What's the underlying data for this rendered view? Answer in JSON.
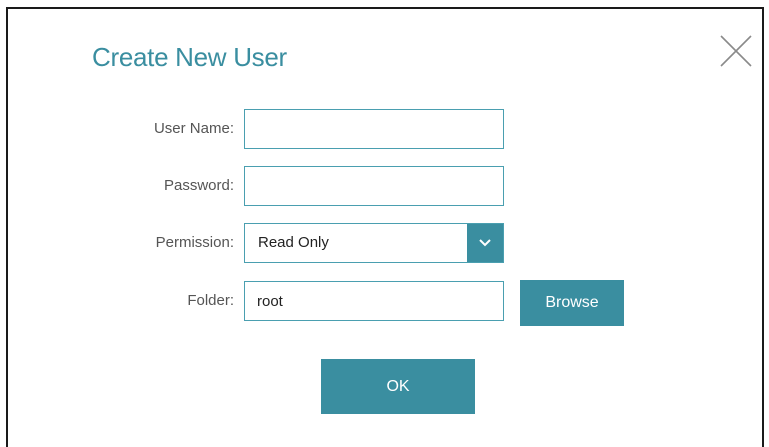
{
  "dialog": {
    "title": "Create New User",
    "close_icon": "close-icon"
  },
  "form": {
    "username": {
      "label": "User Name:",
      "value": ""
    },
    "password": {
      "label": "Password:",
      "value": ""
    },
    "permission": {
      "label": "Permission:",
      "selected": "Read Only",
      "arrow_icon": "chevron-down-icon"
    },
    "folder": {
      "label": "Folder:",
      "value": "root"
    }
  },
  "buttons": {
    "browse_label": "Browse",
    "ok_label": "OK"
  },
  "colors": {
    "accent": "#3a8ea0",
    "border": "#4a9fb0",
    "label_text": "#555555"
  }
}
